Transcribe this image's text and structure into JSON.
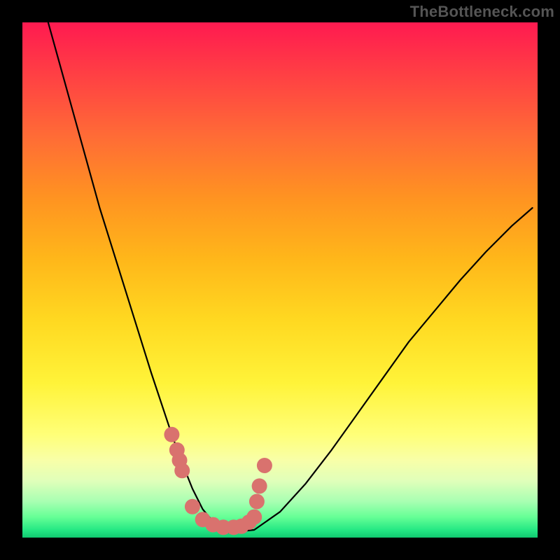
{
  "watermark": {
    "text": "TheBottleneck.com"
  },
  "chart_data": {
    "type": "line",
    "title": "",
    "xlabel": "",
    "ylabel": "",
    "xlim": [
      0,
      100
    ],
    "ylim": [
      0,
      100
    ],
    "series": [
      {
        "name": "bottleneck-curve",
        "x": [
          5,
          7.5,
          10,
          12.5,
          15,
          17.5,
          20,
          22.5,
          25,
          27,
          29,
          31,
          33,
          35,
          37.5,
          40,
          45,
          50,
          55,
          60,
          65,
          70,
          75,
          80,
          85,
          90,
          95,
          99
        ],
        "values": [
          100,
          91,
          82,
          73,
          64,
          56,
          48,
          40,
          32,
          26,
          20,
          14.5,
          9.5,
          5.5,
          2.5,
          1,
          1.5,
          5,
          10.5,
          17,
          24,
          31,
          38,
          44,
          50,
          55.5,
          60.5,
          64
        ]
      }
    ],
    "highlight_points": {
      "name": "highlight-dots",
      "color": "#d9726e",
      "points": [
        {
          "x": 29,
          "y": 20
        },
        {
          "x": 30,
          "y": 17
        },
        {
          "x": 30.5,
          "y": 15
        },
        {
          "x": 31,
          "y": 13
        },
        {
          "x": 33,
          "y": 6
        },
        {
          "x": 35,
          "y": 3.5
        },
        {
          "x": 37,
          "y": 2.5
        },
        {
          "x": 39,
          "y": 2
        },
        {
          "x": 41,
          "y": 2
        },
        {
          "x": 42.5,
          "y": 2.2
        },
        {
          "x": 44,
          "y": 3
        },
        {
          "x": 45,
          "y": 4
        },
        {
          "x": 45.5,
          "y": 7
        },
        {
          "x": 46,
          "y": 10
        },
        {
          "x": 47,
          "y": 14
        }
      ]
    },
    "gradient_stops": [
      {
        "pct": 0,
        "color": "#ff1a50"
      },
      {
        "pct": 10,
        "color": "#ff3f44"
      },
      {
        "pct": 22,
        "color": "#ff6b36"
      },
      {
        "pct": 34,
        "color": "#ff9321"
      },
      {
        "pct": 46,
        "color": "#ffb71a"
      },
      {
        "pct": 58,
        "color": "#ffd921"
      },
      {
        "pct": 70,
        "color": "#fff339"
      },
      {
        "pct": 80,
        "color": "#ffff78"
      },
      {
        "pct": 85,
        "color": "#f8ffa8"
      },
      {
        "pct": 89,
        "color": "#e0ffba"
      },
      {
        "pct": 93,
        "color": "#a8ffb2"
      },
      {
        "pct": 96,
        "color": "#66ff96"
      },
      {
        "pct": 98.5,
        "color": "#25e884"
      },
      {
        "pct": 100,
        "color": "#10c970"
      }
    ]
  }
}
